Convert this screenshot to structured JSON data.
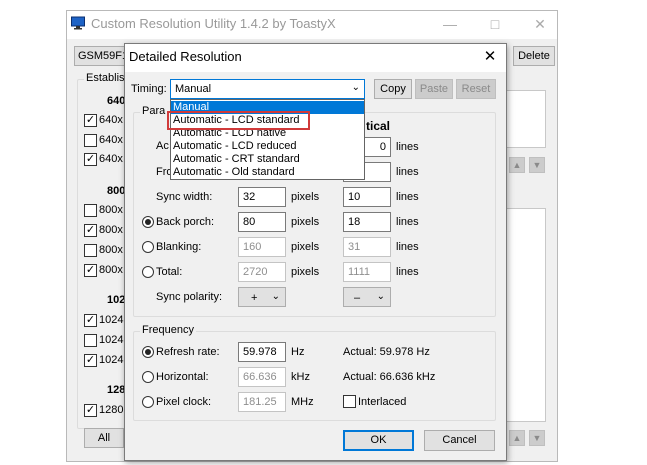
{
  "main_window": {
    "title": "Custom Resolution Utility 1.4.2 by ToastyX",
    "monitor_select": "GSM59F1",
    "delete_label": "Delete",
    "established_label": "Establis",
    "groups": [
      {
        "header": "640",
        "items": [
          {
            "label": "640x",
            "checked": true
          },
          {
            "label": "640x",
            "checked": false
          },
          {
            "label": "640x",
            "checked": true
          }
        ]
      },
      {
        "header": "800",
        "items": [
          {
            "label": "800x",
            "checked": false
          },
          {
            "label": "800x",
            "checked": true
          },
          {
            "label": "800x",
            "checked": false
          },
          {
            "label": "800x",
            "checked": true
          }
        ]
      },
      {
        "header": "102",
        "items": [
          {
            "label": "1024",
            "checked": true
          },
          {
            "label": "1024",
            "checked": false
          },
          {
            "label": "1024",
            "checked": true
          }
        ]
      },
      {
        "header": "128",
        "items": [
          {
            "label": "1280",
            "checked": true
          }
        ]
      }
    ],
    "all_label": "All"
  },
  "dialog": {
    "title": "Detailed Resolution",
    "timing_label": "Timing:",
    "timing_value": "Manual",
    "copy_label": "Copy",
    "paste_label": "Paste",
    "reset_label": "Reset",
    "params_label": "Para",
    "vertical_header": "tical",
    "rows": {
      "active_partial": "Ac",
      "front_partial": "Fro",
      "active_v": "0",
      "lines": "lines",
      "pixels": "pixels",
      "sync_width": {
        "label": "Sync width:",
        "h": "32",
        "v": "10"
      },
      "back_porch": {
        "label": "Back porch:",
        "h": "80",
        "v": "18"
      },
      "blanking": {
        "label": "Blanking:",
        "h": "160",
        "v": "31"
      },
      "total": {
        "label": "Total:",
        "h": "2720",
        "v": "1111"
      },
      "sync_polarity": {
        "label": "Sync polarity:",
        "h": "+",
        "v": "–"
      }
    },
    "frequency": {
      "label": "Frequency",
      "refresh_label": "Refresh rate:",
      "refresh_value": "59.978",
      "refresh_unit": "Hz",
      "refresh_actual": "Actual: 59.978 Hz",
      "horizontal_label": "Horizontal:",
      "horizontal_value": "66.636",
      "horizontal_unit": "kHz",
      "horizontal_actual": "Actual: 66.636 kHz",
      "pixel_label": "Pixel clock:",
      "pixel_value": "181.25",
      "pixel_unit": "MHz",
      "interlaced_label": "Interlaced"
    },
    "ok_label": "OK",
    "cancel_label": "Cancel"
  },
  "timing_dropdown": {
    "options": [
      "Manual",
      "Automatic - LCD standard",
      "Automatic - LCD native",
      "Automatic - LCD reduced",
      "Automatic - CRT standard",
      "Automatic - Old standard"
    ],
    "selected_index": 0,
    "highlighted_index": 1,
    "highlight_color": "#d03a3a"
  },
  "colors": {
    "selection": "#0078d7"
  }
}
